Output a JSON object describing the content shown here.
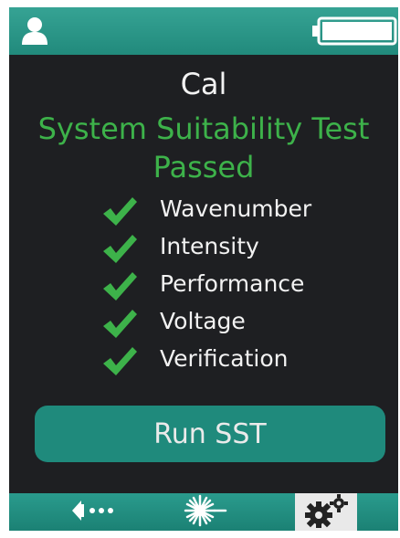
{
  "header": {
    "user_icon": "user-icon",
    "battery_icon": "battery-icon"
  },
  "screen": {
    "title": "Cal",
    "status_line1": "System Suitability Test",
    "status_line2": "Passed",
    "status_color": "#3db24a",
    "checks": [
      {
        "label": "Wavenumber",
        "passed": true
      },
      {
        "label": "Intensity",
        "passed": true
      },
      {
        "label": "Performance",
        "passed": true
      },
      {
        "label": "Voltage",
        "passed": true
      },
      {
        "label": "Verification",
        "passed": true
      }
    ],
    "run_button_label": "Run SST"
  },
  "footer": {
    "items": [
      {
        "icon": "back-icon",
        "selected": false
      },
      {
        "icon": "laser-icon",
        "selected": false
      },
      {
        "icon": "settings-gears-icon",
        "selected": true
      }
    ]
  },
  "colors": {
    "accent": "#2a9b8d",
    "background": "#1e1f22",
    "check": "#3db24a"
  }
}
